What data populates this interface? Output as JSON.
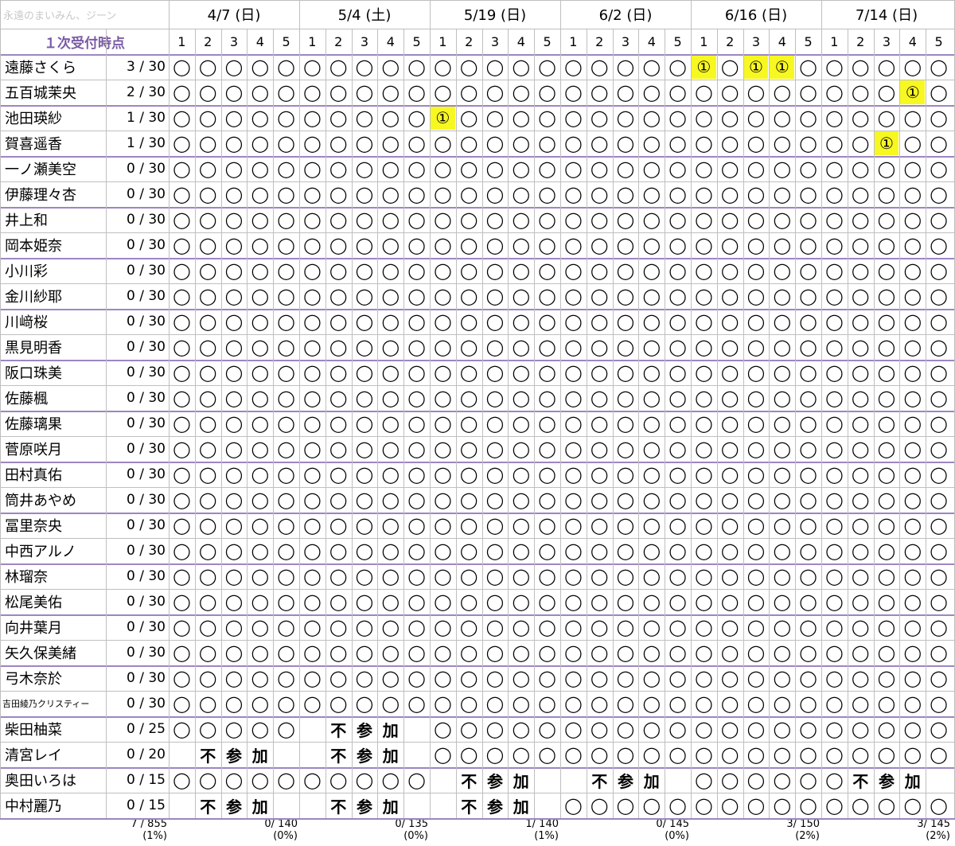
{
  "watermark": "永遠のまいみん、ジーン",
  "header_label": "１次受付時点",
  "dates": [
    "4/7 (日)",
    "5/4 (土)",
    "5/19 (日)",
    "6/2 (日)",
    "6/16 (日)",
    "7/14 (日)"
  ],
  "slot_labels": [
    "1",
    "2",
    "3",
    "4",
    "5"
  ],
  "unavailable_chars": [
    "不",
    "参",
    "加"
  ],
  "available_mark": "◯",
  "won_mark": "①",
  "members": [
    {
      "name": "遠藤さくら",
      "count": "3 / 30",
      "small": false,
      "marks": "oooooooooooooooooooo1o11ooooooo"
    },
    {
      "name": "五百城茉央",
      "count": "2 / 30",
      "small": false,
      "marks": "oooooooooooooooooooooooooooo1o1"
    },
    {
      "name": "池田瑛紗",
      "count": "1 / 30",
      "small": false,
      "marks": "oooooooooo1ooooooooooooooooooo"
    },
    {
      "name": "賀喜遥香",
      "count": "1 / 30",
      "small": false,
      "marks": "ooooooooooooooooooooooooooo1ooo"
    },
    {
      "name": "一ノ瀬美空",
      "count": "0 / 30",
      "small": false,
      "marks": "oooooooooooooooooooooooooooooo"
    },
    {
      "name": "伊藤理々杏",
      "count": "0 / 30",
      "small": false,
      "marks": "oooooooooooooooooooooooooooooo"
    },
    {
      "name": "井上和",
      "count": "0 / 30",
      "small": false,
      "marks": "oooooooooooooooooooooooooooooo"
    },
    {
      "name": "岡本姫奈",
      "count": "0 / 30",
      "small": false,
      "marks": "oooooooooooooooooooooooooooooo"
    },
    {
      "name": "小川彩",
      "count": "0 / 30",
      "small": false,
      "marks": "oooooooooooooooooooooooooooooo"
    },
    {
      "name": "金川紗耶",
      "count": "0 / 30",
      "small": false,
      "marks": "oooooooooooooooooooooooooooooo"
    },
    {
      "name": "川﨑桜",
      "count": "0 / 30",
      "small": false,
      "marks": "oooooooooooooooooooooooooooooo"
    },
    {
      "name": "黒見明香",
      "count": "0 / 30",
      "small": false,
      "marks": "oooooooooooooooooooooooooooooo"
    },
    {
      "name": "阪口珠美",
      "count": "0 / 30",
      "small": false,
      "marks": "oooooooooooooooooooooooooooooo"
    },
    {
      "name": "佐藤楓",
      "count": "0 / 30",
      "small": false,
      "marks": "oooooooooooooooooooooooooooooo"
    },
    {
      "name": "佐藤璃果",
      "count": "0 / 30",
      "small": false,
      "marks": "oooooooooooooooooooooooooooooo"
    },
    {
      "name": "菅原咲月",
      "count": "0 / 30",
      "small": false,
      "marks": "oooooooooooooooooooooooooooooo"
    },
    {
      "name": "田村真佑",
      "count": "0 / 30",
      "small": false,
      "marks": "oooooooooooooooooooooooooooooo"
    },
    {
      "name": "筒井あやめ",
      "count": "0 / 30",
      "small": false,
      "marks": "oooooooooooooooooooooooooooooo"
    },
    {
      "name": "冨里奈央",
      "count": "0 / 30",
      "small": false,
      "marks": "oooooooooooooooooooooooooooooo"
    },
    {
      "name": "中西アルノ",
      "count": "0 / 30",
      "small": false,
      "marks": "oooooooooooooooooooooooooooooo"
    },
    {
      "name": "林瑠奈",
      "count": "0 / 30",
      "small": false,
      "marks": "oooooooooooooooooooooooooooooo"
    },
    {
      "name": "松尾美佑",
      "count": "0 / 30",
      "small": false,
      "marks": "oooooooooooooooooooooooooooooo"
    },
    {
      "name": "向井葉月",
      "count": "0 / 30",
      "small": false,
      "marks": "oooooooooooooooooooooooooooooo"
    },
    {
      "name": "矢久保美緒",
      "count": "0 / 30",
      "small": false,
      "marks": "oooooooooooooooooooooooooooooo"
    },
    {
      "name": "弓木奈於",
      "count": "0 / 30",
      "small": false,
      "marks": "oooooooooooooooooooooooooooooo"
    },
    {
      "name": "吉田綾乃クリスティー",
      "count": "0 / 30",
      "small": true,
      "marks": "oooooooooooooooooooooooooooooo"
    },
    {
      "name": "柴田柚菜",
      "count": "0 / 25",
      "small": false,
      "marks": "oooooxxxxxoooooooooooooooooooo"
    },
    {
      "name": "清宮レイ",
      "count": "0 / 20",
      "small": false,
      "marks": "xxxxxxxxxxoooooooooooooooooooo"
    },
    {
      "name": "奥田いろは",
      "count": "0 / 15",
      "small": false,
      "marks": "ooooooooooxxxxxxxxxxooooooxxxxx"
    },
    {
      "name": "中村麗乃",
      "count": "0 / 15",
      "small": false,
      "marks": "xxxxxxxxxxxxxxxooooooooooooooo"
    }
  ],
  "totals": [
    {
      "value": "7 /  855",
      "pct": "(1%)"
    },
    {
      "value": "0/  140",
      "pct": "(0%)"
    },
    {
      "value": "0/  135",
      "pct": "(0%)"
    },
    {
      "value": "1/  140",
      "pct": "(1%)"
    },
    {
      "value": "0/  145",
      "pct": "(0%)"
    },
    {
      "value": "3/  150",
      "pct": "(2%)"
    },
    {
      "value": "3/  145",
      "pct": "(2%)"
    }
  ],
  "colors": {
    "grid_gray": "#bfbfbf",
    "grid_purple": "#9d86c2",
    "highlight": "#f7f722",
    "header_label": "#7a5ca6"
  }
}
